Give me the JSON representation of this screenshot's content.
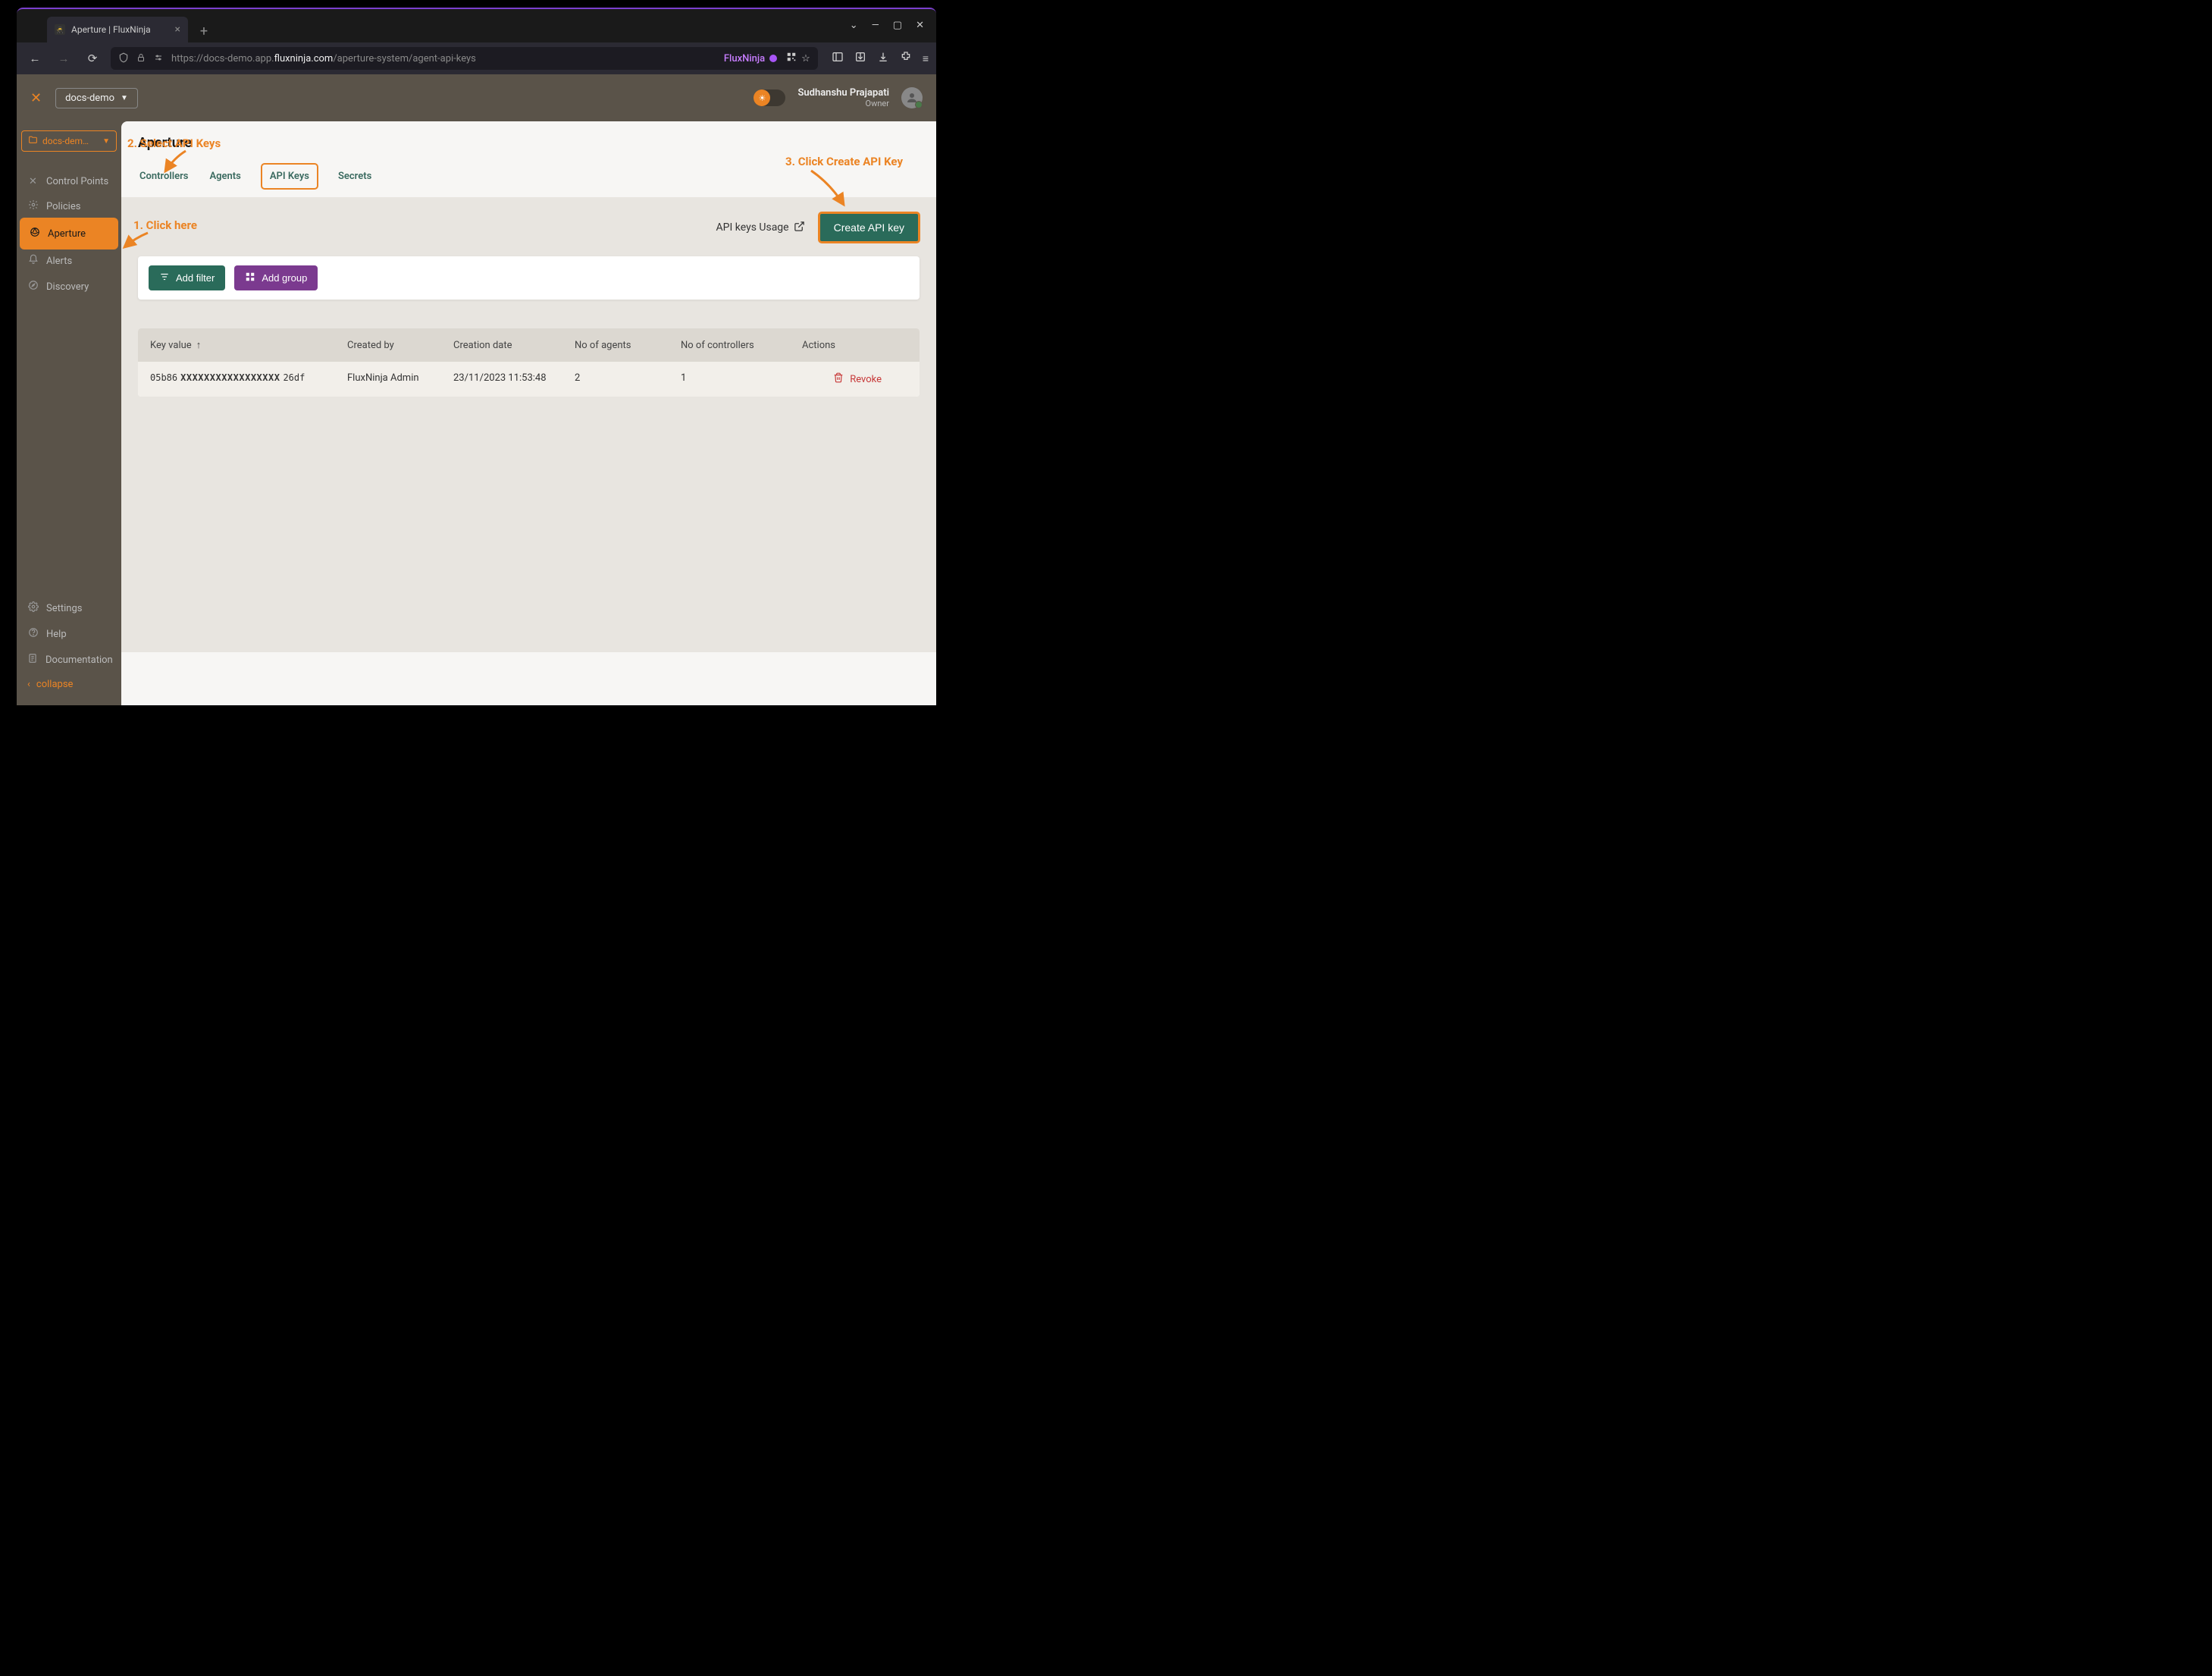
{
  "browser": {
    "tab_title": "Aperture | FluxNinja",
    "url_prefix": "https://docs-demo.app.",
    "url_domain": "fluxninja.com",
    "url_path": "/aperture-system/agent-api-keys",
    "ext_label": "FluxNinja"
  },
  "app_header": {
    "project": "docs-demo",
    "user_name": "Sudhanshu Prajapati",
    "user_role": "Owner"
  },
  "sidebar": {
    "project_label": "docs-dem…",
    "items": [
      {
        "label": "Control Points"
      },
      {
        "label": "Policies"
      },
      {
        "label": "Aperture"
      },
      {
        "label": "Alerts"
      },
      {
        "label": "Discovery"
      }
    ],
    "bottom": [
      {
        "label": "Settings"
      },
      {
        "label": "Help"
      },
      {
        "label": "Documentation"
      }
    ],
    "collapse": "collapse"
  },
  "content": {
    "page_title": "Aperture",
    "tabs": [
      {
        "label": "Controllers"
      },
      {
        "label": "Agents"
      },
      {
        "label": "API Keys"
      },
      {
        "label": "Secrets"
      }
    ],
    "usage_link": "API keys Usage",
    "create_button": "Create API key",
    "add_filter": "Add filter",
    "add_group": "Add group",
    "columns": {
      "key_value": "Key value",
      "created_by": "Created by",
      "creation_date": "Creation date",
      "no_agents": "No of agents",
      "no_controllers": "No of controllers",
      "actions": "Actions"
    },
    "rows": [
      {
        "key_prefix": "05b86",
        "key_mask": "XXXXXXXXXXXXXXXXX",
        "key_suffix": "26df",
        "created_by": "FluxNinja Admin",
        "creation_date": "23/11/2023 11:53:48",
        "agents": "2",
        "controllers": "1",
        "revoke": "Revoke"
      }
    ]
  },
  "annotations": {
    "a1": "1. Click here",
    "a2": "2. Select API Keys",
    "a3": "3. Click Create API Key"
  }
}
